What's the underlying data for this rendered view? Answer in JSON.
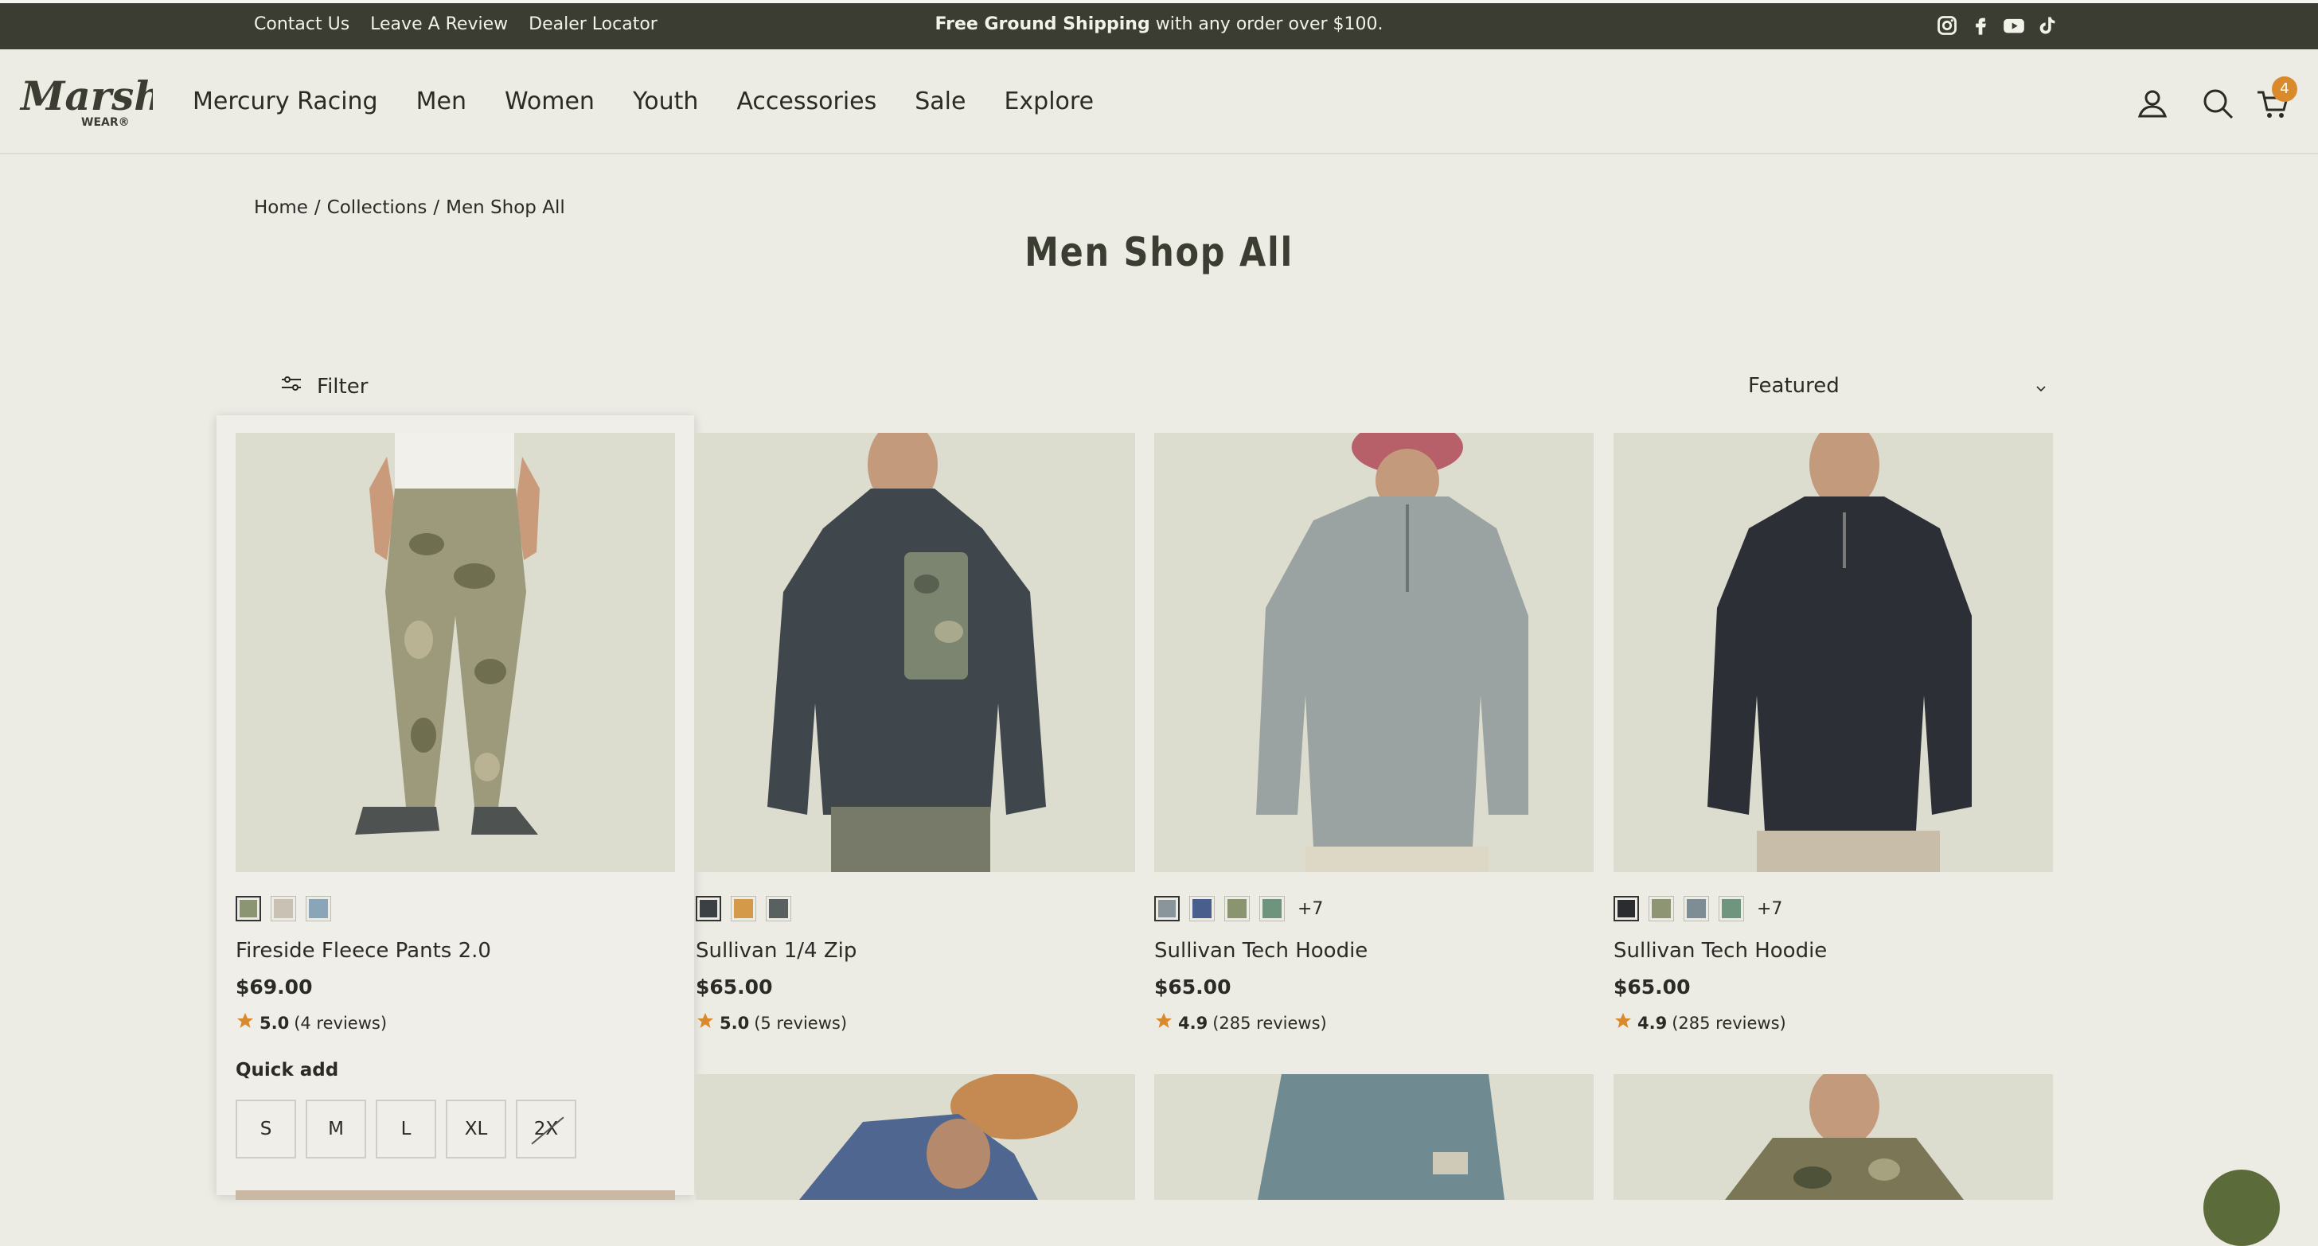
{
  "topbar": {
    "links": [
      "Contact Us",
      "Leave A Review",
      "Dealer Locator"
    ],
    "promo_bold": "Free Ground Shipping",
    "promo_rest": " with any order over $100.",
    "social": [
      "instagram-icon",
      "facebook-icon",
      "youtube-icon",
      "tiktok-icon"
    ]
  },
  "header": {
    "logo_text": "Marsh",
    "logo_sub": "WEAR®",
    "nav": [
      "Mercury Racing",
      "Men",
      "Women",
      "Youth",
      "Accessories",
      "Sale",
      "Explore"
    ],
    "cart_count": "4"
  },
  "breadcrumb": [
    "Home",
    "/",
    "Collections",
    "/",
    "Men Shop All"
  ],
  "page_title": "Men Shop All",
  "toolbar": {
    "filter_label": "Filter",
    "sort_value": "Featured"
  },
  "products": [
    {
      "name": "Fireside Fleece Pants 2.0",
      "price": "$69.00",
      "rating": "5.0",
      "reviews": "(4 reviews)",
      "swatches": [
        "#8b9574",
        "#c9c2b4",
        "#8aa5b8"
      ],
      "more": "",
      "quick_add_label": "Quick add",
      "sizes": [
        "S",
        "M",
        "L",
        "XL",
        "2X"
      ],
      "size_available": [
        true,
        true,
        true,
        true,
        false
      ]
    },
    {
      "name": "Sullivan 1/4 Zip",
      "price": "$65.00",
      "rating": "5.0",
      "reviews": "(5 reviews)",
      "swatches": [
        "#3b4045",
        "#d49a4a",
        "#5a5f60"
      ],
      "more": ""
    },
    {
      "name": "Sullivan Tech Hoodie",
      "price": "$65.00",
      "rating": "4.9",
      "reviews": "(285 reviews)",
      "swatches": [
        "#8a959b",
        "#4a5e8e",
        "#8a9470",
        "#6e947e"
      ],
      "more": "+7"
    },
    {
      "name": "Sullivan Tech Hoodie",
      "price": "$65.00",
      "rating": "4.9",
      "reviews": "(285 reviews)",
      "swatches": [
        "#2a2c30",
        "#8d9573",
        "#7e8c94",
        "#6f957e"
      ],
      "more": "+7"
    }
  ],
  "colors": {
    "topbar_bg": "#3b3d32",
    "page_bg": "#ecebe4",
    "badge": "#d98b2b",
    "star": "#d98b2b"
  }
}
